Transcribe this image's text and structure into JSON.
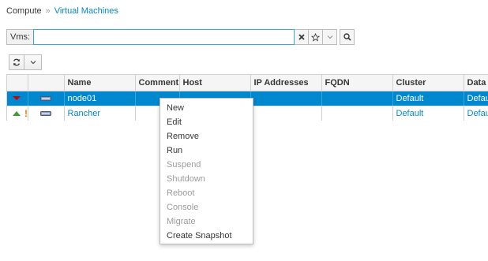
{
  "breadcrumb": {
    "root": "Compute",
    "separator": "»",
    "current": "Virtual Machines"
  },
  "search": {
    "label": "Vms:",
    "value": ""
  },
  "colors": {
    "accent": "#0088ce",
    "selected_row": "#0088ce",
    "status_down": "#cc0000",
    "status_up": "#3f9c35",
    "alert": "#ec7a08"
  },
  "icons": {
    "clear": "close-icon",
    "bookmark": "star-icon",
    "more": "chevron-down-icon",
    "search": "search-icon",
    "refresh": "refresh-icon",
    "vm": "vm-icon"
  },
  "grid": {
    "columns": [
      "Name",
      "Comment",
      "Host",
      "IP Addresses",
      "FQDN",
      "Cluster",
      "Data Center"
    ],
    "rows": [
      {
        "status": "down",
        "alert": "",
        "name": "node01",
        "comment": "",
        "host": "",
        "ip": "",
        "fqdn": "",
        "cluster": "Default",
        "datacenter": "Default",
        "selected": true
      },
      {
        "status": "up",
        "alert": "!",
        "name": "Rancher",
        "comment": "",
        "host": "",
        "ip": "",
        "fqdn": "",
        "cluster": "Default",
        "datacenter": "Default",
        "selected": false
      }
    ]
  },
  "context_menu": {
    "items": [
      {
        "label": "New",
        "enabled": true
      },
      {
        "label": "Edit",
        "enabled": true
      },
      {
        "label": "Remove",
        "enabled": true
      },
      {
        "label": "Run",
        "enabled": true
      },
      {
        "label": "Suspend",
        "enabled": false
      },
      {
        "label": "Shutdown",
        "enabled": false
      },
      {
        "label": "Reboot",
        "enabled": false
      },
      {
        "label": "Console",
        "enabled": false
      },
      {
        "label": "Migrate",
        "enabled": false
      },
      {
        "label": "Create Snapshot",
        "enabled": true
      }
    ]
  }
}
